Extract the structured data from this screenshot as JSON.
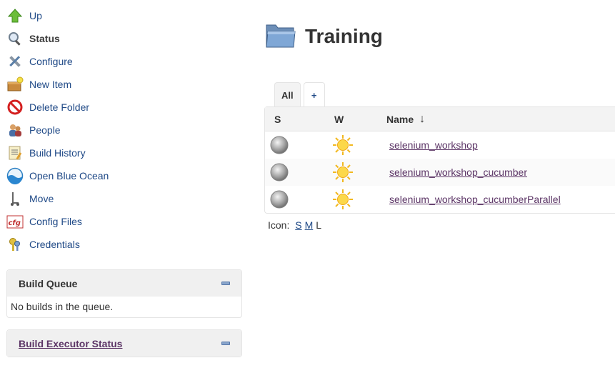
{
  "sidebar": {
    "items": [
      {
        "label": "Up",
        "icon": "up-arrow-icon"
      },
      {
        "label": "Status",
        "icon": "magnifier-icon",
        "active": true
      },
      {
        "label": "Configure",
        "icon": "wrench-screwdriver-icon"
      },
      {
        "label": "New Item",
        "icon": "new-item-box-icon"
      },
      {
        "label": "Delete Folder",
        "icon": "delete-no-icon"
      },
      {
        "label": "People",
        "icon": "people-icon"
      },
      {
        "label": "Build History",
        "icon": "notepad-icon"
      },
      {
        "label": "Open Blue Ocean",
        "icon": "blue-ocean-icon"
      },
      {
        "label": "Move",
        "icon": "move-icon"
      },
      {
        "label": "Config Files",
        "icon": "cfg-file-icon"
      },
      {
        "label": "Credentials",
        "icon": "keys-icon"
      }
    ]
  },
  "build_queue": {
    "title": "Build Queue",
    "message": "No builds in the queue."
  },
  "executor_status": {
    "title": "Build Executor Status"
  },
  "main": {
    "title": "Training",
    "tabs": {
      "all": "All",
      "add": "+"
    },
    "columns": {
      "s": "S",
      "w": "W",
      "name": "Name",
      "sort_arrow": "↓"
    },
    "jobs": [
      {
        "name": "selenium_workshop",
        "status": "grey-ball-icon",
        "weather": "sunny-icon"
      },
      {
        "name": "selenium_workshop_cucumber",
        "status": "grey-ball-icon",
        "weather": "sunny-icon"
      },
      {
        "name": "selenium_workshop_cucumberParallel",
        "status": "grey-ball-icon",
        "weather": "sunny-icon"
      }
    ],
    "icon_size": {
      "label": "Icon:",
      "small": "S",
      "medium": "M",
      "large": "L"
    }
  },
  "colors": {
    "link": "#204a87",
    "visited_link": "#5c3566",
    "pane_header": "#f0f0f0"
  }
}
